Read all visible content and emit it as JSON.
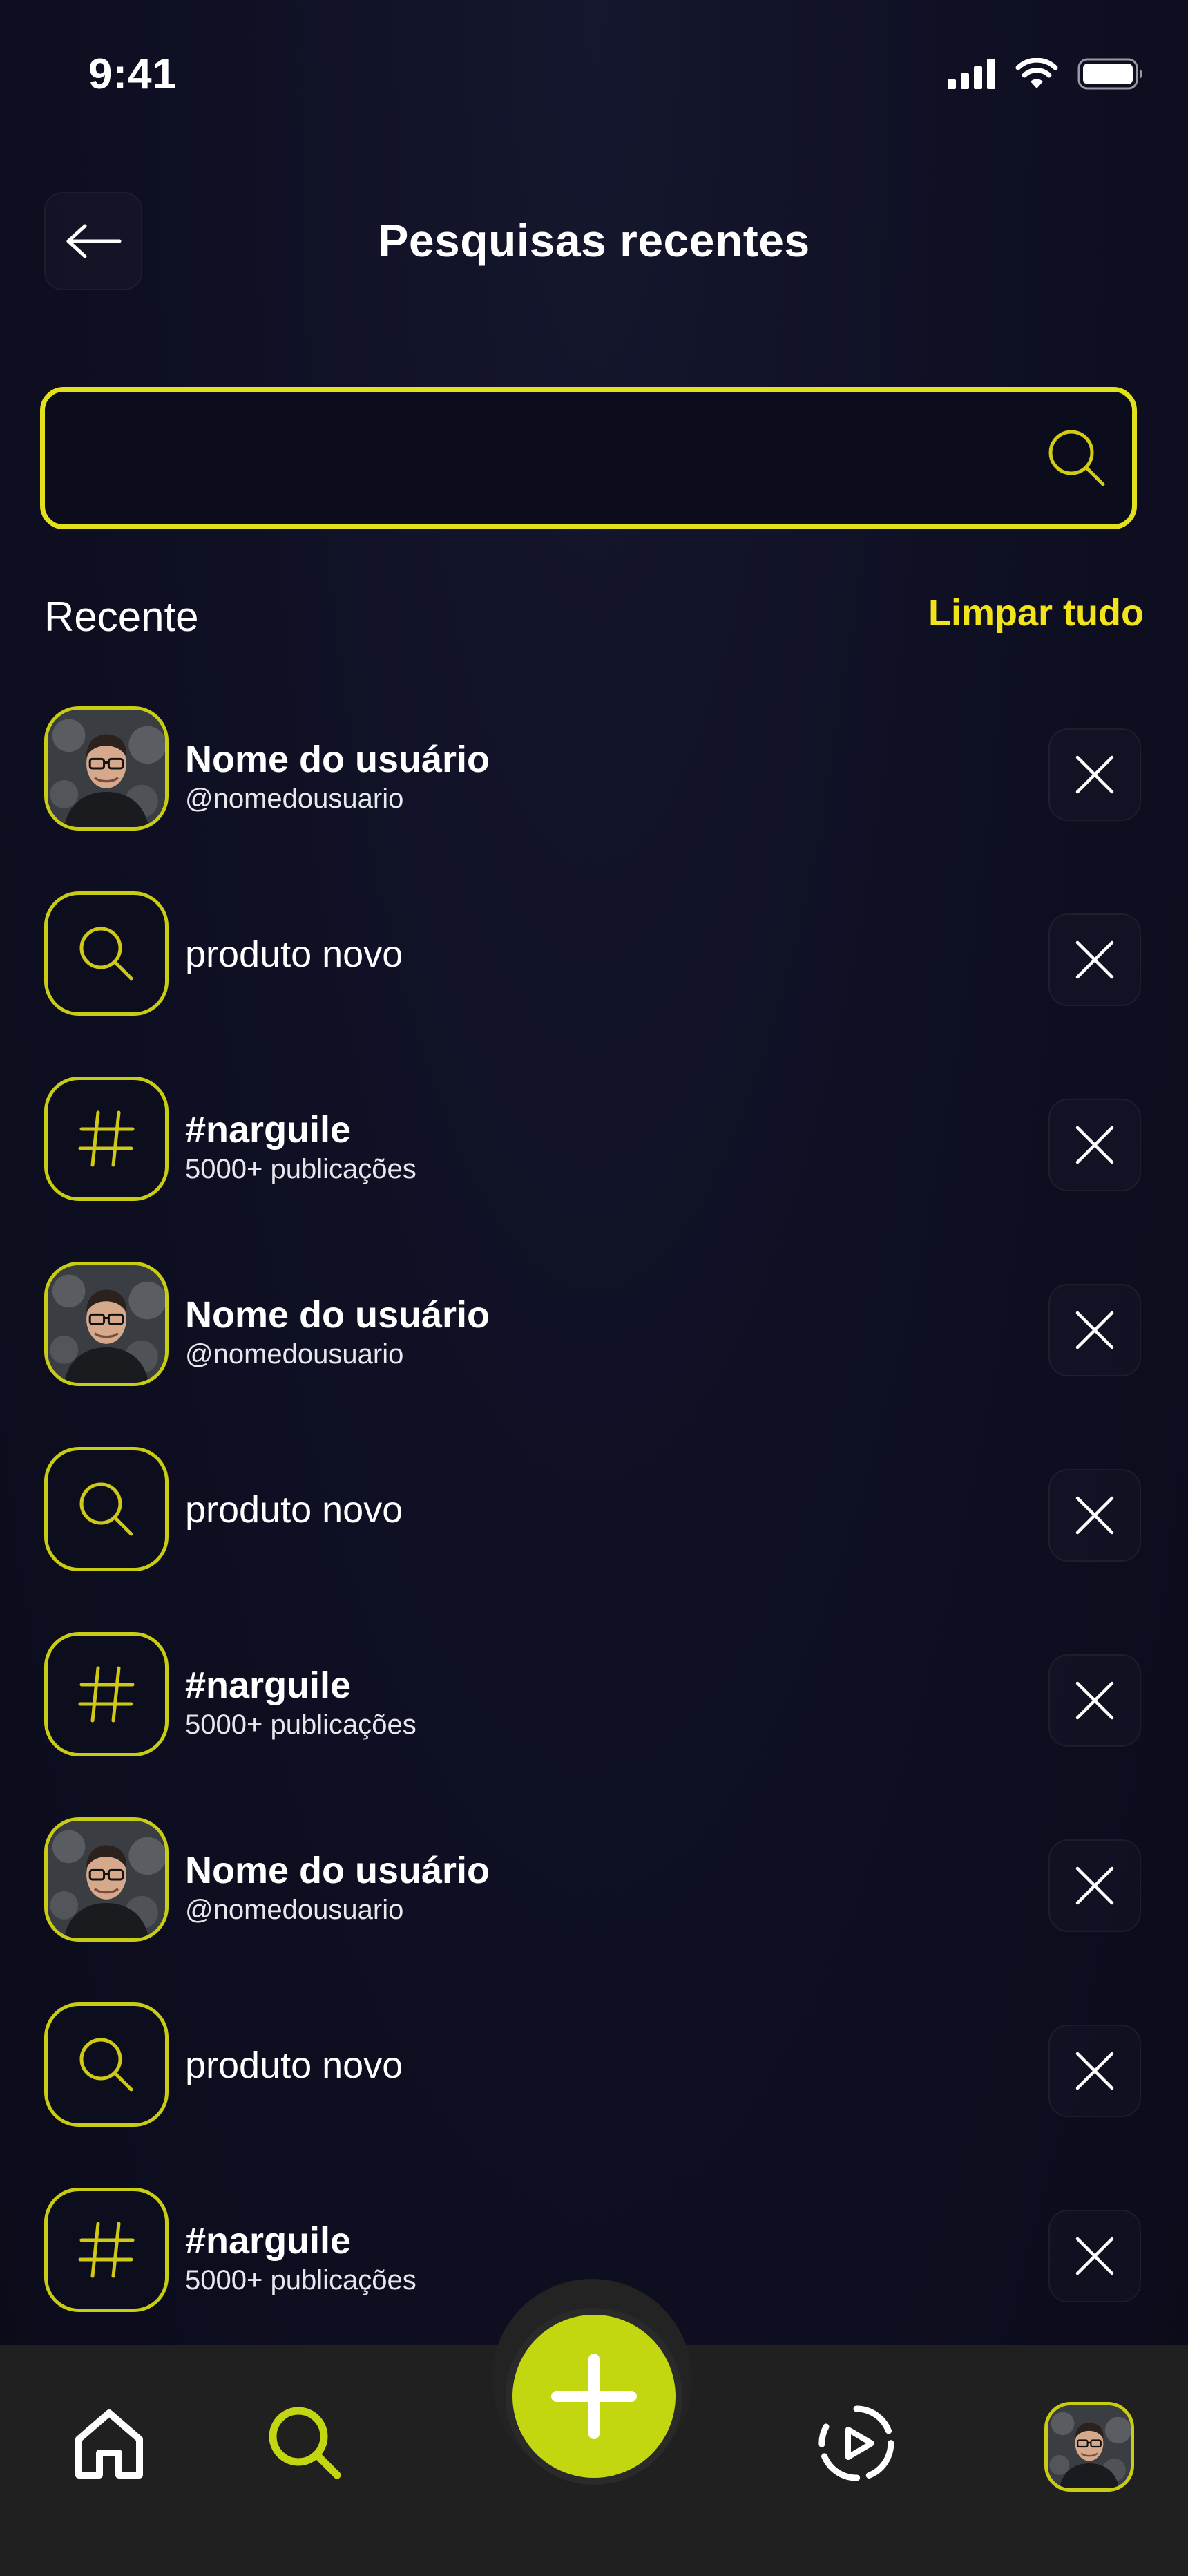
{
  "status_bar": {
    "time": "9:41"
  },
  "header": {
    "title": "Pesquisas recentes"
  },
  "search": {
    "value": "",
    "placeholder": ""
  },
  "section": {
    "title": "Recente",
    "clear_label": "Limpar tudo"
  },
  "recent_items": [
    {
      "type": "user",
      "title": "Nome do usuário",
      "subtitle": "@nomedousuario"
    },
    {
      "type": "search",
      "title": "produto novo"
    },
    {
      "type": "hashtag",
      "title": "#narguile",
      "subtitle": "5000+ publicações"
    },
    {
      "type": "user",
      "title": "Nome do usuário",
      "subtitle": "@nomedousuario"
    },
    {
      "type": "search",
      "title": "produto novo"
    },
    {
      "type": "hashtag",
      "title": "#narguile",
      "subtitle": "5000+ publicações"
    },
    {
      "type": "user",
      "title": "Nome do usuário",
      "subtitle": "@nomedousuario"
    },
    {
      "type": "search",
      "title": "produto novo"
    },
    {
      "type": "hashtag",
      "title": "#narguile",
      "subtitle": "5000+ publicações"
    }
  ],
  "tab_bar": {
    "tabs": [
      {
        "name": "home",
        "icon": "home-icon",
        "active": false
      },
      {
        "name": "search",
        "icon": "search-icon",
        "active": true
      },
      {
        "name": "create",
        "icon": "plus-icon",
        "active": false
      },
      {
        "name": "videos",
        "icon": "play-circle-icon",
        "active": false
      },
      {
        "name": "profile",
        "icon": "avatar",
        "active": false
      }
    ]
  },
  "colors": {
    "accent": "#e3e11a",
    "fab": "#c3d711",
    "background": "#0f1024",
    "tabbar": "#202020"
  }
}
